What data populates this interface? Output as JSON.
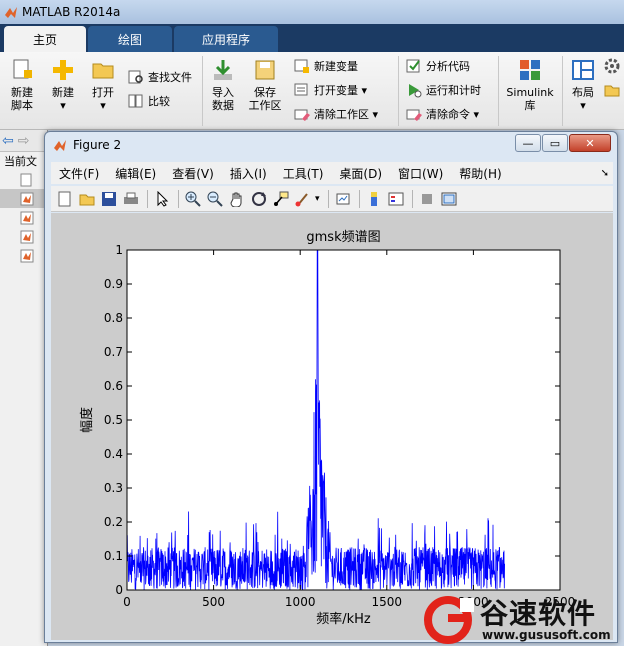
{
  "matlab": {
    "title": "MATLAB R2014a",
    "tabs": [
      "主页",
      "绘图",
      "应用程序"
    ],
    "ribbon": {
      "new_script": [
        "新建",
        "脚本"
      ],
      "new": "新建",
      "open": "打开",
      "find_files": "查找文件",
      "compare": "比较",
      "import_data": [
        "导入",
        "数据"
      ],
      "save_workspace": [
        "保存",
        "工作区"
      ],
      "new_variable": "新建变量",
      "open_variable": "打开变量",
      "clear_workspace": "清除工作区",
      "analyze_code": "分析代码",
      "run_and_time": "运行和计时",
      "clear_commands": "清除命令",
      "simulink": [
        "Simulink",
        "库"
      ],
      "layout": "布局"
    },
    "current_folder_label": "当前文"
  },
  "figure": {
    "title": "Figure 2",
    "menu": [
      "文件(F)",
      "编辑(E)",
      "查看(V)",
      "插入(I)",
      "工具(T)",
      "桌面(D)",
      "窗口(W)",
      "帮助(H)"
    ],
    "colors": {
      "line": "#0000ff",
      "axes_bg": "#ffffff",
      "figure_bg": "#cccccc"
    }
  },
  "chart_data": {
    "type": "line",
    "title": "gmsk频谱图",
    "xlabel": "频率/kHz",
    "ylabel": "幅度",
    "xlim": [
      0,
      2500
    ],
    "ylim": [
      0,
      1
    ],
    "xticks": [
      0,
      500,
      1000,
      1500,
      2000,
      2500
    ],
    "xtick_labels": [
      "0",
      "500",
      "1000",
      "1500",
      "2000",
      "2500"
    ],
    "yticks": [
      0,
      0.1,
      0.2,
      0.3,
      0.4,
      0.5,
      0.6,
      0.7,
      0.8,
      0.9,
      1
    ],
    "ytick_labels": [
      "0",
      "0.1",
      "0.2",
      "0.3",
      "0.4",
      "0.5",
      "0.6",
      "0.7",
      "0.8",
      "0.9",
      "1"
    ],
    "grid": false,
    "series": [
      {
        "color": "#0000ff",
        "x_range": [
          0,
          2180
        ],
        "peak_frequency": 1100,
        "peak_amplitude": 1.0,
        "noise_floor_amplitude": [
          0,
          0.18
        ]
      }
    ]
  },
  "watermark": {
    "brand": "谷速软件",
    "url": "www.gususoft.com"
  }
}
